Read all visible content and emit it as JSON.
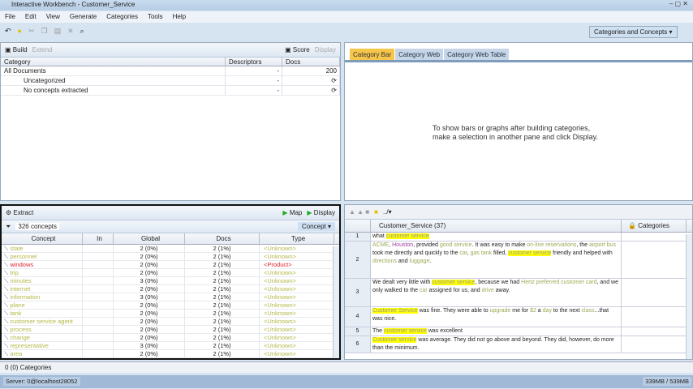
{
  "window": {
    "title": "Interactive Workbench - Customer_Service",
    "controls": "‒ ▢ ✕"
  },
  "menu": [
    "File",
    "Edit",
    "View",
    "Generate",
    "Categories",
    "Tools",
    "Help"
  ],
  "toolbar": {
    "view_select": "Categories and Concepts"
  },
  "categories_pane": {
    "build": "Build",
    "extend": "Extend",
    "score": "Score",
    "display": "Display",
    "columns": [
      "Category",
      "Descriptors",
      "Docs"
    ],
    "rows": [
      {
        "name": "All Documents",
        "desc": "-",
        "docs": "200"
      },
      {
        "name": "Uncategorized",
        "desc": "-",
        "docs": "⟳"
      },
      {
        "name": "No concepts extracted",
        "desc": "-",
        "docs": "⟳"
      }
    ]
  },
  "viz_pane": {
    "tabs": [
      "Category Bar",
      "Category Web",
      "Category Web Table"
    ],
    "message_line1": "To show bars or graphs after building categories,",
    "message_line2": "make a selection in another pane and click Display."
  },
  "extract_pane": {
    "extract": "Extract",
    "map": "Map",
    "display": "Display",
    "filter_count": "326 concepts",
    "view": "Concept",
    "columns": [
      "Concept",
      "In",
      "Global",
      "Docs",
      "Type"
    ],
    "rows": [
      {
        "c": "state",
        "g": "2 (0%)",
        "d": "2 (1%)",
        "t": "<Unknown>",
        "color": "#b5b84a"
      },
      {
        "c": "personnel",
        "g": "2 (0%)",
        "d": "2 (1%)",
        "t": "<Unknown>",
        "color": "#b5b84a"
      },
      {
        "c": "windows",
        "g": "2 (0%)",
        "d": "2 (1%)",
        "t": "<Product>",
        "color": "#e0202a"
      },
      {
        "c": "trip",
        "g": "2 (0%)",
        "d": "2 (1%)",
        "t": "<Unknown>",
        "color": "#b5b84a"
      },
      {
        "c": "minutes",
        "g": "3 (0%)",
        "d": "2 (1%)",
        "t": "<Unknown>",
        "color": "#b5b84a"
      },
      {
        "c": "internet",
        "g": "2 (0%)",
        "d": "2 (1%)",
        "t": "<Unknown>",
        "color": "#b5b84a"
      },
      {
        "c": "information",
        "g": "3 (0%)",
        "d": "2 (1%)",
        "t": "<Unknown>",
        "color": "#b5b84a"
      },
      {
        "c": "plane",
        "g": "2 (0%)",
        "d": "2 (1%)",
        "t": "<Unknown>",
        "color": "#b5b84a"
      },
      {
        "c": "tank",
        "g": "2 (0%)",
        "d": "2 (1%)",
        "t": "<Unknown>",
        "color": "#b5b84a"
      },
      {
        "c": "customer service agent",
        "g": "2 (0%)",
        "d": "2 (1%)",
        "t": "<Unknown>",
        "color": "#b5b84a"
      },
      {
        "c": "process",
        "g": "2 (0%)",
        "d": "2 (1%)",
        "t": "<Unknown>",
        "color": "#b5b84a"
      },
      {
        "c": "change",
        "g": "2 (0%)",
        "d": "2 (1%)",
        "t": "<Unknown>",
        "color": "#b5b84a"
      },
      {
        "c": "representative",
        "g": "3 (0%)",
        "d": "2 (1%)",
        "t": "<Unknown>",
        "color": "#b5b84a"
      },
      {
        "c": "area",
        "g": "2 (0%)",
        "d": "2 (1%)",
        "t": "<Unknown>",
        "color": "#b5b84a"
      }
    ]
  },
  "text_pane": {
    "header": "Customer_Service (37)",
    "categories_col": "Categories",
    "rows": [
      {
        "n": "1",
        "html": "what <span class='hl'>customer service</span>"
      },
      {
        "n": "2",
        "html": "<span class='c'>ACME</span>, <span class='p'>Houston</span>, provided <span class='c'>good service</span>. It was easy to make <span class='c'>on-line reservations</span>, the <span class='c'>airport bus</span> took me directly and quickly to the <span class='c'>car</span>, <span class='c'>gas tank</span> filled, <span class='hl'>customer service</span> friendly and helped with <span class='c'>directions</span> and <span class='c'>luggage</span>."
      },
      {
        "n": "3",
        "html": "We dealt very little with <span class='hl'>customer service</span>, because we had <span class='c'>Hertz preferred customer card</span>, and we only walked to the <span class='c'>car</span> assigned for us, and <span class='c'>drive</span> away."
      },
      {
        "n": "4",
        "html": "<span class='hl'>Customer Service</span> was fine. They were able to <span class='c'>upgrade</span> me for <span class='c'>$2</span> a <span class='c'>day</span> to the next <span class='c'>class</span>...that was nice."
      },
      {
        "n": "5",
        "html": "The <span class='hl'>customer service</span> was excellent"
      },
      {
        "n": "6",
        "html": "<span class='hl'>Customer service</span> was average. They did not go above and beyond. They did, however, do more than the minimum."
      }
    ]
  },
  "status": {
    "categories": "0 (0) Categories",
    "server": "Server: 0@localhost28052",
    "memory": "339MB / 539MB"
  }
}
